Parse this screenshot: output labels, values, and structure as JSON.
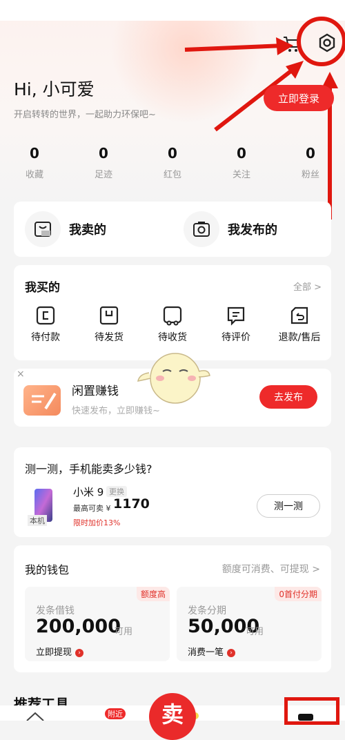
{
  "header": {
    "greeting": "Hi, 小可爱",
    "subtitle": "开启转转的世界，一起助力环保吧~",
    "login_label": "立即登录"
  },
  "stats": [
    {
      "value": "0",
      "label": "收藏"
    },
    {
      "value": "0",
      "label": "足迹"
    },
    {
      "value": "0",
      "label": "红包"
    },
    {
      "value": "0",
      "label": "关注"
    },
    {
      "value": "0",
      "label": "粉丝"
    }
  ],
  "sell_section": {
    "my_sold": "我卖的",
    "my_posted": "我发布的"
  },
  "buy_section": {
    "title": "我买的",
    "all_label": "全部 >",
    "items": [
      {
        "label": "待付款",
        "icon": "wallet-icon"
      },
      {
        "label": "待发货",
        "icon": "package-icon"
      },
      {
        "label": "待收货",
        "icon": "truck-icon"
      },
      {
        "label": "待评价",
        "icon": "comment-icon"
      },
      {
        "label": "退款/售后",
        "icon": "refund-icon"
      }
    ]
  },
  "promo": {
    "close": "×",
    "title": "闲置赚钱",
    "subtitle": "快速发布，立即赚钱~",
    "button": "去发布"
  },
  "phone_test": {
    "title": "测一测，手机能卖多少钱?",
    "badge": "本机",
    "model": "小米 9",
    "change": "更换",
    "price_label": "最高可卖 ¥",
    "price": "1170",
    "bonus": "限时加价13%",
    "button": "测一测"
  },
  "wallet": {
    "title": "我的钱包",
    "desc": "额度可消费、可提现 >",
    "boxes": [
      {
        "tag": "额度高",
        "name": "发条借钱",
        "amount": "200,000",
        "avail": "可用",
        "action": "立即提现"
      },
      {
        "tag": "0首付分期",
        "name": "发条分期",
        "amount": "50,000",
        "avail": "可用",
        "action": "消费一笔"
      }
    ]
  },
  "recommend_title": "推荐工具",
  "tabbar": {
    "nearby_badge": "附近",
    "sell_label": "卖"
  },
  "colors": {
    "accent": "#ee2a2a",
    "annotation": "#e0170f"
  }
}
